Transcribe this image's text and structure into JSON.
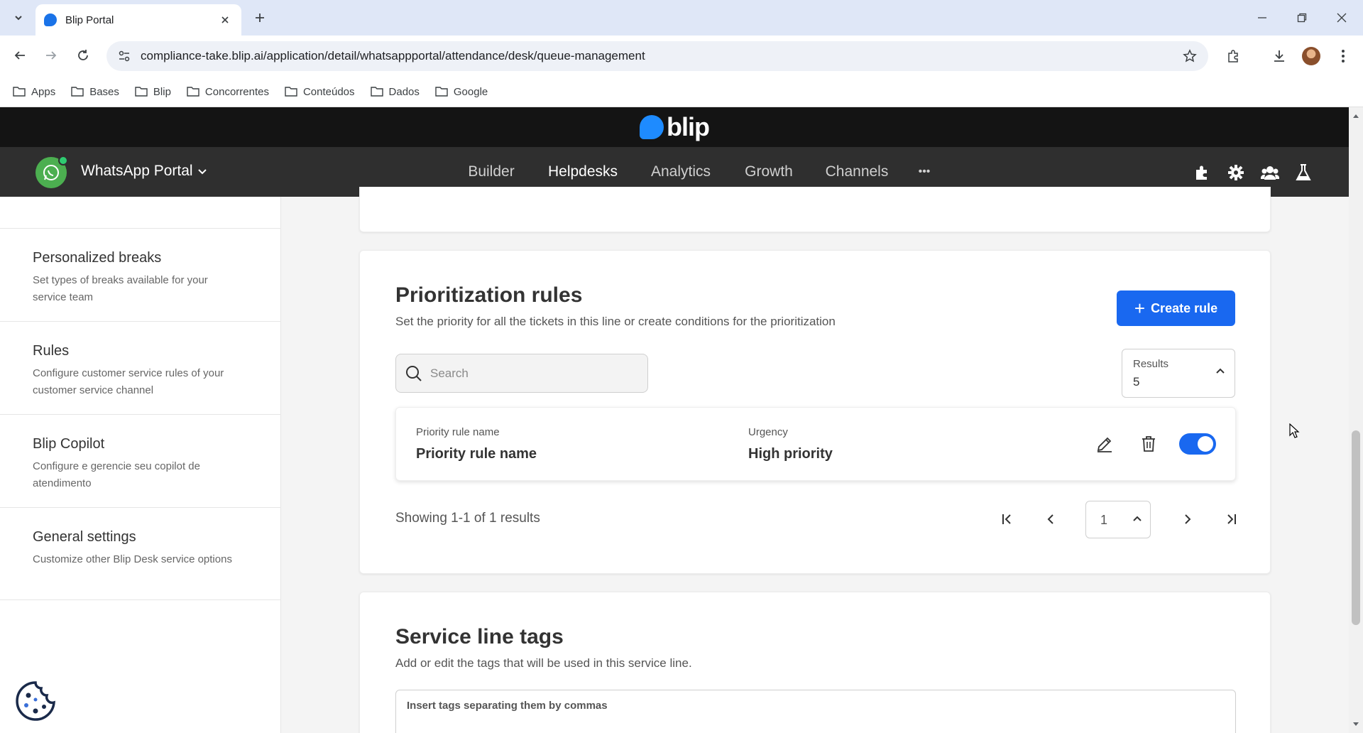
{
  "browser": {
    "tab_title": "Blip Portal",
    "url": "compliance-take.blip.ai/application/detail/whatsappportal/attendance/desk/queue-management",
    "bookmarks": [
      "Apps",
      "Bases",
      "Blip",
      "Concorrentes",
      "Conteúdos",
      "Dados",
      "Google"
    ]
  },
  "header": {
    "logo_text": "blip",
    "bot_name": "WhatsApp Portal",
    "nav": [
      "Builder",
      "Helpdesks",
      "Analytics",
      "Growth",
      "Channels"
    ],
    "active_nav": "Helpdesks",
    "more_label": "•••"
  },
  "sidebar": {
    "items": [
      {
        "title": "Personalized breaks",
        "desc": "Set types of breaks available for your service team"
      },
      {
        "title": "Rules",
        "desc": "Configure customer service rules of your customer service channel"
      },
      {
        "title": "Blip Copilot",
        "desc": "Configure e gerencie seu copilot de atendimento"
      },
      {
        "title": "General settings",
        "desc": "Customize other Blip Desk service options"
      }
    ]
  },
  "prioritization": {
    "title": "Prioritization rules",
    "subtitle": "Set the priority for all the tickets in this line or create conditions for the prioritization",
    "create_button": "Create rule",
    "search_placeholder": "Search",
    "results_label": "Results",
    "results_value": "5",
    "rules": [
      {
        "name_label": "Priority rule name",
        "name": "Priority rule name",
        "urgency_label": "Urgency",
        "urgency": "High priority",
        "enabled": true
      }
    ],
    "showing": "Showing 1-1 of 1 results",
    "page": "1"
  },
  "tags": {
    "title": "Service line tags",
    "subtitle": "Add or edit the tags that will be used in this service line.",
    "input_placeholder": "Insert tags separating them by commas"
  },
  "colors": {
    "accent": "#1968f0",
    "blip_blue": "#1e8bff",
    "header_dark": "#141414",
    "nav_dark": "#2f2f2f"
  }
}
